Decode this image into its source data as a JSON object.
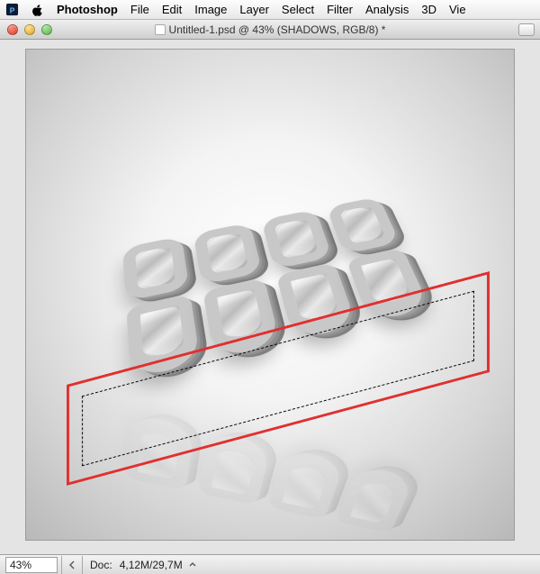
{
  "menubar": {
    "items": [
      "Photoshop",
      "File",
      "Edit",
      "Image",
      "Layer",
      "Select",
      "Filter",
      "Analysis",
      "3D",
      "Vie"
    ]
  },
  "window": {
    "title": "Untitled-1.psd @ 43% (SHADOWS, RGB/8) *"
  },
  "status": {
    "zoom": "43%",
    "doc_label": "Doc:",
    "doc_size": "4,12M/29,7M"
  }
}
